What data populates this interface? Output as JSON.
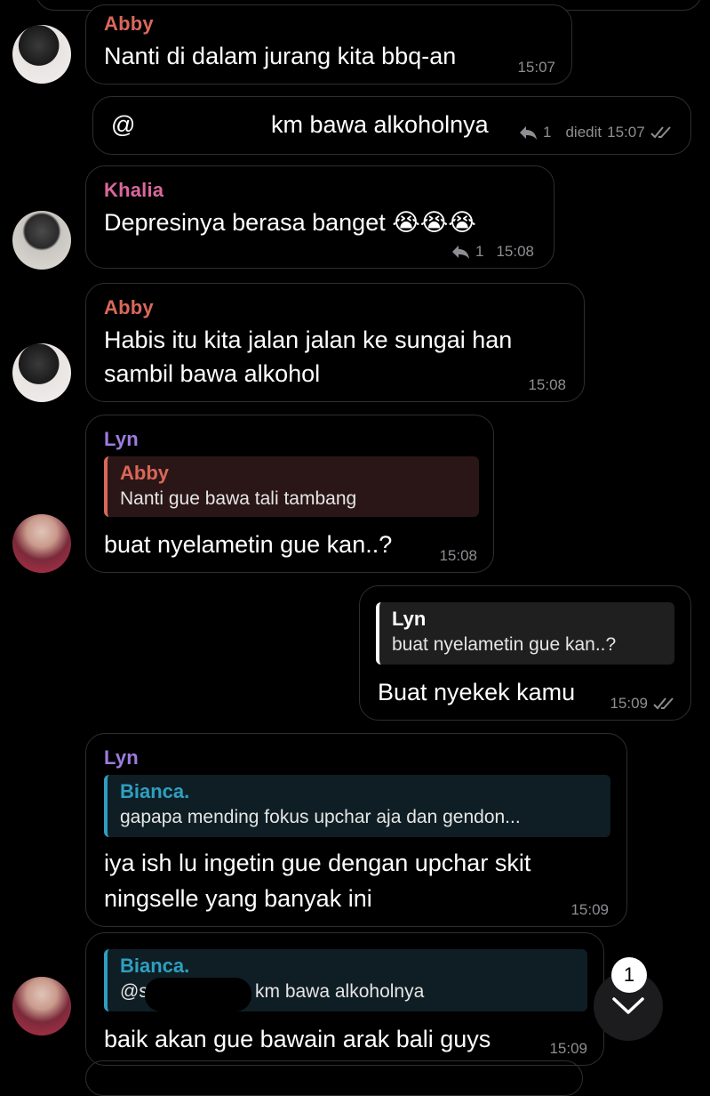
{
  "colors": {
    "abby": "#d9685a",
    "khalia": "#d9689c",
    "lyn": "#9d7ce0",
    "bianca": "#2e9fc0",
    "bubble_border": "#2e2e2e",
    "meta": "#8e8e93"
  },
  "messages": [
    {
      "sender": "Abby",
      "text": "Nanti di dalam jurang kita bbq-an",
      "time": "15:07"
    },
    {
      "prefix": "@",
      "text": "km bawa alkoholnya",
      "reply_count": "1",
      "edited": "diedit",
      "time": "15:07",
      "icons": [
        "reply-icon",
        "double-check-icon"
      ]
    },
    {
      "sender": "Khalia",
      "text": "Depresinya berasa banget 😭😭😭",
      "reply_count": "1",
      "time": "15:08",
      "icons": [
        "reply-icon"
      ]
    },
    {
      "sender": "Abby",
      "line1": "Habis itu kita jalan jalan ke sungai han",
      "line2": "sambil bawa alkohol",
      "time": "15:08"
    },
    {
      "sender": "Lyn",
      "quote_name": "Abby",
      "quote_text": "Nanti gue bawa tali tambang",
      "text": "buat nyelametin gue kan..?",
      "time": "15:08"
    },
    {
      "quote_name": "Lyn",
      "quote_text": "buat nyelametin gue kan..?",
      "text": "Buat nyekek kamu",
      "time": "15:09",
      "icons": [
        "double-check-icon"
      ]
    },
    {
      "sender": "Lyn",
      "quote_name": "Bianca.",
      "quote_text": "gapapa mending fokus upchar aja dan gendon...",
      "line1": "iya ish lu ingetin gue dengan upchar skit",
      "line2": "ningselle yang banyak ini",
      "time": "15:09"
    },
    {
      "quote_name": "Bianca.",
      "quote_prefix": "@s",
      "quote_text": "km bawa alkoholnya",
      "text": "baik akan gue bawain arak bali guys",
      "time": "15:09"
    }
  ],
  "scroll_button": {
    "badge": "1",
    "icon": "chevron-down-icon"
  }
}
